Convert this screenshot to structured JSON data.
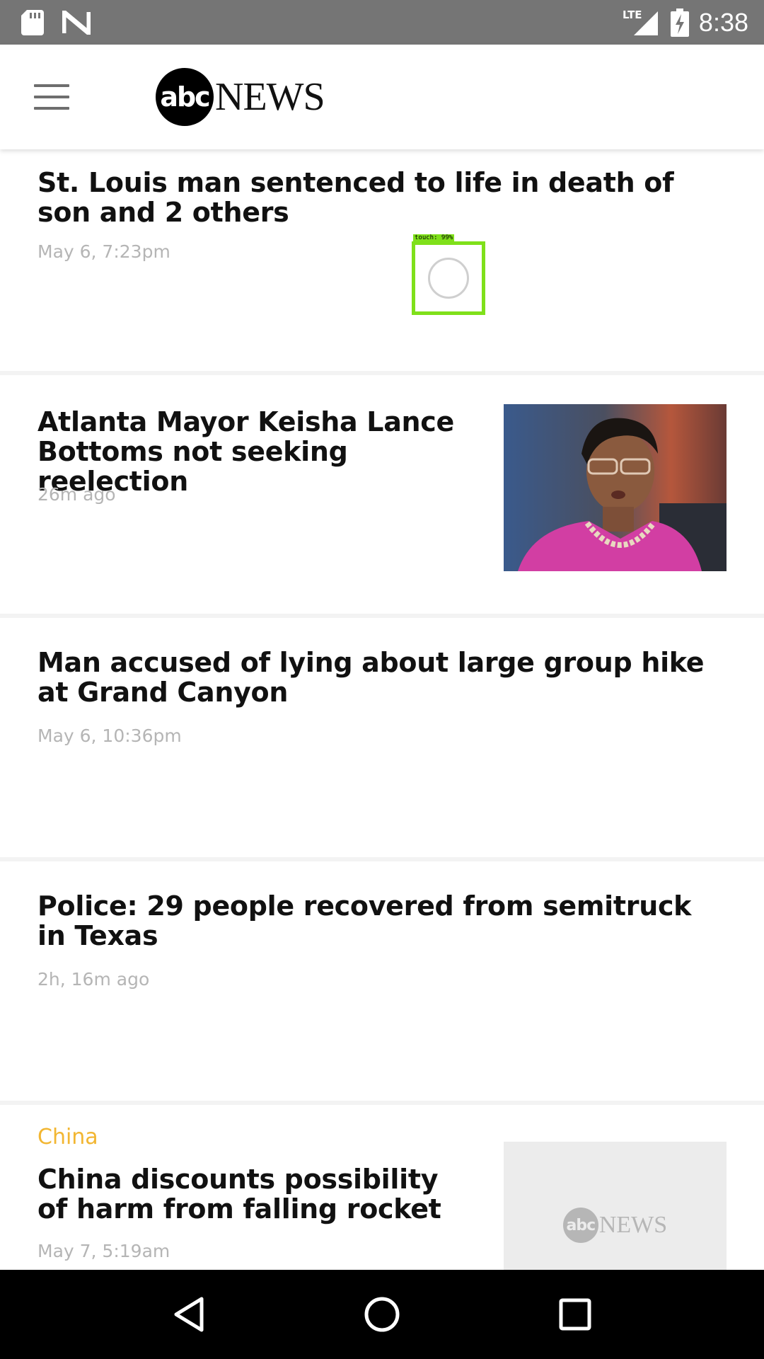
{
  "status_bar": {
    "time": "8:38",
    "network": "LTE",
    "icons": [
      "sd-card-icon",
      "n-app-icon",
      "lte-signal-icon",
      "battery-charging-icon"
    ]
  },
  "header": {
    "logo_mark": "abc",
    "logo_text": "NEWS",
    "menu_icon": "hamburger-menu-icon"
  },
  "touch_indicator": {
    "label": "touch: 99%"
  },
  "articles": [
    {
      "headline": "St. Louis man sentenced to life in death of son and 2 others",
      "timestamp": "May 6, 7:23pm"
    },
    {
      "headline": "Atlanta Mayor Keisha Lance Bottoms not seeking reelection",
      "timestamp": "26m ago",
      "image": "woman-portrait-photo"
    },
    {
      "headline": "Man accused of lying about large group hike at Grand Canyon",
      "timestamp": "May 6, 10:36pm"
    },
    {
      "headline": "Police: 29 people recovered from semitruck in Texas",
      "timestamp": "2h, 16m ago"
    },
    {
      "category": "China",
      "headline": "China discounts possibility of harm from falling rocket",
      "timestamp": "May 7, 5:19am",
      "image_placeholder_mark": "abc",
      "image_placeholder_text": "NEWS"
    }
  ],
  "nav_bar": {
    "icons": [
      "back-icon",
      "home-icon",
      "recents-icon"
    ]
  },
  "colors": {
    "status_bar": "#757575",
    "category_accent": "#f2b632",
    "touch_box": "#7fe01a",
    "timestamp": "#b5b5b5"
  }
}
